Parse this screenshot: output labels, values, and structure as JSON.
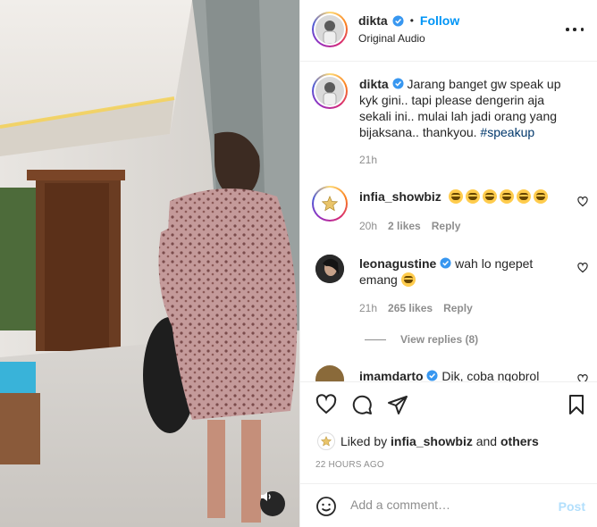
{
  "header": {
    "username": "dikta",
    "separator": "•",
    "follow_label": "Follow",
    "audio_label": "Original Audio",
    "more_icon": "more-horizontal-icon"
  },
  "caption": {
    "username": "dikta",
    "text": "Jarang banget gw speak up kyk gini.. tapi please dengerin aja sekali ini.. mulai lah jadi orang yang bijaksana.. thankyou.",
    "hashtag": "#speakup",
    "time": "21h"
  },
  "comments": [
    {
      "username": "infia_showbiz",
      "emoji_count": 6,
      "text": "",
      "time": "20h",
      "likes": "2 likes",
      "reply": "Reply"
    },
    {
      "username": "leonagustine",
      "text": "wah lo ngepet emang",
      "emoji_count": 1,
      "time": "21h",
      "likes": "265 likes",
      "reply": "Reply",
      "view_replies": "View replies (8)"
    },
    {
      "username": "imamdarto",
      "text": "Dik, coba ngobrol"
    }
  ],
  "liked_by": {
    "prefix": "Liked by",
    "user": "infia_showbiz",
    "and": "and",
    "others": "others"
  },
  "posted_ago": "22 HOURS AGO",
  "composer": {
    "placeholder": "Add a comment…",
    "post_label": "Post"
  },
  "colors": {
    "link": "#0095f6",
    "verified": "#3897f0",
    "muted": "#8e8e8e",
    "post_disabled": "#b2dffc"
  }
}
